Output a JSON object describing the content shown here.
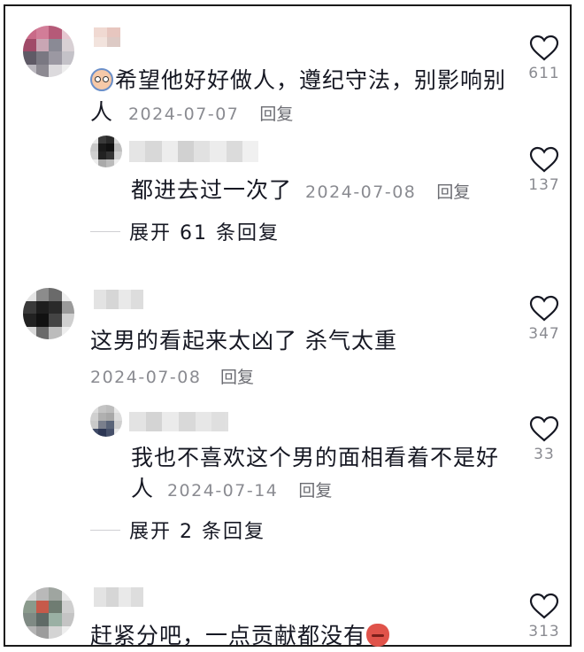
{
  "comments": [
    {
      "text_line1": "希望他好好做人，遵纪守法，别影响别",
      "text_line2": "人",
      "date": "2024-07-07",
      "reply_label": "回复",
      "likes": "611",
      "emoji": "blushing-face-emoji",
      "replies": [
        {
          "text": "都进去过一次了",
          "date": "2024-07-08",
          "reply_label": "回复",
          "likes": "137"
        }
      ],
      "expand_label": "展开 61 条回复"
    },
    {
      "text_line1": "这男的看起来太凶了 杀气太重",
      "date": "2024-07-08",
      "reply_label": "回复",
      "likes": "347",
      "replies": [
        {
          "text_line1": "我也不喜欢这个男的面相看着不是好",
          "text_line2": "人",
          "date": "2024-07-14",
          "reply_label": "回复",
          "likes": "33"
        }
      ],
      "expand_label": "展开 2 条回复"
    },
    {
      "text_line1": "赶紧分吧，一点贡献都没有",
      "likes": "313",
      "emoji": "angry-face-emoji"
    }
  ],
  "icons": {
    "like": "heart-outline-icon"
  },
  "colors": {
    "text": "#161823",
    "meta": "#8a8b91",
    "border": "#1a1a1a"
  }
}
